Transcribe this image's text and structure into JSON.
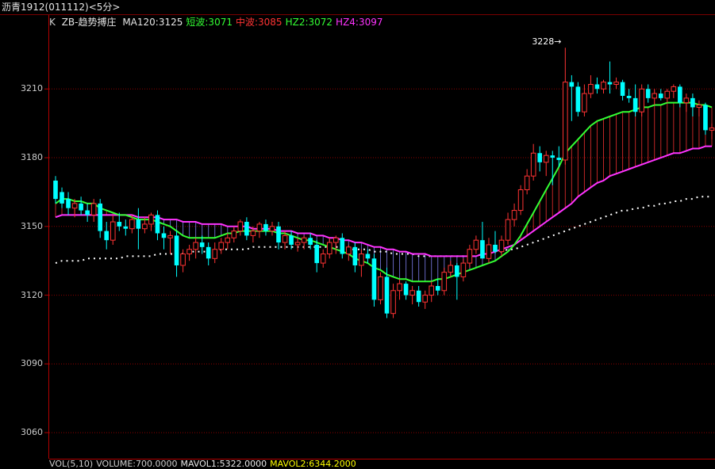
{
  "window": {
    "title": "沥青1912(011112)<5分>"
  },
  "legend": {
    "prefix": "K",
    "indicator": "ZB-趋势搏庄",
    "items": [
      {
        "text": "MA120:3125",
        "color": "#e6e6e6"
      },
      {
        "text": "短波:3071",
        "color": "#33ff33"
      },
      {
        "text": "中波:3085",
        "color": "#ff3333"
      },
      {
        "text": "HZ2:3072",
        "color": "#33ff33"
      },
      {
        "text": "HZ4:3097",
        "color": "#ff33ff"
      }
    ]
  },
  "volume_bar": {
    "items": [
      {
        "text": "VOL(5,10)",
        "color": "#ccc"
      },
      {
        "text": "VOLUME:700.0000",
        "color": "#ccc"
      },
      {
        "text": "MAVOL1:5322.0000",
        "color": "#e6e6e6"
      },
      {
        "text": "MAVOL2:6344.2000",
        "color": "#ffff00"
      }
    ]
  },
  "annotations": {
    "peak": "3228"
  },
  "colors": {
    "up": "#ff3333",
    "down": "#00ffff",
    "hz2": "#33ff33",
    "hz4": "#ff33ff",
    "ma120": "#ffffff",
    "grid": "#8b0000"
  },
  "chart_data": {
    "type": "candlestick",
    "ylim": [
      3050,
      3235
    ],
    "yticks": [
      3060,
      3090,
      3120,
      3150,
      3180,
      3210
    ],
    "grid": true,
    "candles": [
      {
        "o": 3170,
        "h": 3172,
        "l": 3160,
        "c": 3162
      },
      {
        "o": 3165,
        "h": 3167,
        "l": 3158,
        "c": 3160
      },
      {
        "o": 3162,
        "h": 3165,
        "l": 3155,
        "c": 3158
      },
      {
        "o": 3158,
        "h": 3162,
        "l": 3154,
        "c": 3160
      },
      {
        "o": 3160,
        "h": 3163,
        "l": 3155,
        "c": 3157
      },
      {
        "o": 3157,
        "h": 3160,
        "l": 3152,
        "c": 3155
      },
      {
        "o": 3155,
        "h": 3162,
        "l": 3152,
        "c": 3160
      },
      {
        "o": 3160,
        "h": 3162,
        "l": 3145,
        "c": 3148
      },
      {
        "o": 3148,
        "h": 3152,
        "l": 3140,
        "c": 3144
      },
      {
        "o": 3144,
        "h": 3155,
        "l": 3142,
        "c": 3152
      },
      {
        "o": 3152,
        "h": 3156,
        "l": 3148,
        "c": 3150
      },
      {
        "o": 3150,
        "h": 3153,
        "l": 3146,
        "c": 3149
      },
      {
        "o": 3149,
        "h": 3155,
        "l": 3147,
        "c": 3153
      },
      {
        "o": 3153,
        "h": 3158,
        "l": 3140,
        "c": 3149
      },
      {
        "o": 3149,
        "h": 3154,
        "l": 3147,
        "c": 3151
      },
      {
        "o": 3151,
        "h": 3156,
        "l": 3148,
        "c": 3155
      },
      {
        "o": 3155,
        "h": 3157,
        "l": 3144,
        "c": 3147
      },
      {
        "o": 3147,
        "h": 3150,
        "l": 3140,
        "c": 3145
      },
      {
        "o": 3145,
        "h": 3148,
        "l": 3138,
        "c": 3146
      },
      {
        "o": 3146,
        "h": 3148,
        "l": 3128,
        "c": 3133
      },
      {
        "o": 3133,
        "h": 3140,
        "l": 3130,
        "c": 3138
      },
      {
        "o": 3138,
        "h": 3142,
        "l": 3135,
        "c": 3140
      },
      {
        "o": 3140,
        "h": 3145,
        "l": 3136,
        "c": 3143
      },
      {
        "o": 3143,
        "h": 3146,
        "l": 3138,
        "c": 3141
      },
      {
        "o": 3141,
        "h": 3143,
        "l": 3133,
        "c": 3136
      },
      {
        "o": 3136,
        "h": 3143,
        "l": 3134,
        "c": 3140
      },
      {
        "o": 3140,
        "h": 3145,
        "l": 3138,
        "c": 3143
      },
      {
        "o": 3143,
        "h": 3147,
        "l": 3140,
        "c": 3145
      },
      {
        "o": 3145,
        "h": 3150,
        "l": 3143,
        "c": 3148
      },
      {
        "o": 3148,
        "h": 3153,
        "l": 3146,
        "c": 3152
      },
      {
        "o": 3152,
        "h": 3154,
        "l": 3144,
        "c": 3146
      },
      {
        "o": 3146,
        "h": 3150,
        "l": 3143,
        "c": 3148
      },
      {
        "o": 3148,
        "h": 3152,
        "l": 3145,
        "c": 3151
      },
      {
        "o": 3151,
        "h": 3153,
        "l": 3146,
        "c": 3148
      },
      {
        "o": 3148,
        "h": 3152,
        "l": 3146,
        "c": 3150
      },
      {
        "o": 3150,
        "h": 3152,
        "l": 3140,
        "c": 3143
      },
      {
        "o": 3143,
        "h": 3148,
        "l": 3140,
        "c": 3146
      },
      {
        "o": 3146,
        "h": 3148,
        "l": 3140,
        "c": 3142
      },
      {
        "o": 3142,
        "h": 3145,
        "l": 3139,
        "c": 3143
      },
      {
        "o": 3143,
        "h": 3146,
        "l": 3140,
        "c": 3145
      },
      {
        "o": 3145,
        "h": 3147,
        "l": 3140,
        "c": 3142
      },
      {
        "o": 3142,
        "h": 3144,
        "l": 3130,
        "c": 3134
      },
      {
        "o": 3134,
        "h": 3140,
        "l": 3132,
        "c": 3138
      },
      {
        "o": 3138,
        "h": 3145,
        "l": 3136,
        "c": 3143
      },
      {
        "o": 3143,
        "h": 3146,
        "l": 3138,
        "c": 3145
      },
      {
        "o": 3145,
        "h": 3147,
        "l": 3136,
        "c": 3138
      },
      {
        "o": 3138,
        "h": 3142,
        "l": 3135,
        "c": 3141
      },
      {
        "o": 3141,
        "h": 3143,
        "l": 3130,
        "c": 3133
      },
      {
        "o": 3133,
        "h": 3140,
        "l": 3128,
        "c": 3138
      },
      {
        "o": 3138,
        "h": 3140,
        "l": 3134,
        "c": 3136
      },
      {
        "o": 3136,
        "h": 3138,
        "l": 3115,
        "c": 3118
      },
      {
        "o": 3118,
        "h": 3130,
        "l": 3116,
        "c": 3128
      },
      {
        "o": 3128,
        "h": 3132,
        "l": 3110,
        "c": 3112
      },
      {
        "o": 3112,
        "h": 3125,
        "l": 3110,
        "c": 3122
      },
      {
        "o": 3122,
        "h": 3127,
        "l": 3118,
        "c": 3125
      },
      {
        "o": 3125,
        "h": 3126,
        "l": 3118,
        "c": 3120
      },
      {
        "o": 3120,
        "h": 3124,
        "l": 3116,
        "c": 3122
      },
      {
        "o": 3122,
        "h": 3124,
        "l": 3115,
        "c": 3117
      },
      {
        "o": 3117,
        "h": 3122,
        "l": 3114,
        "c": 3120
      },
      {
        "o": 3120,
        "h": 3126,
        "l": 3117,
        "c": 3124
      },
      {
        "o": 3124,
        "h": 3127,
        "l": 3120,
        "c": 3122
      },
      {
        "o": 3122,
        "h": 3132,
        "l": 3120,
        "c": 3130
      },
      {
        "o": 3130,
        "h": 3135,
        "l": 3128,
        "c": 3133
      },
      {
        "o": 3133,
        "h": 3134,
        "l": 3118,
        "c": 3128
      },
      {
        "o": 3128,
        "h": 3136,
        "l": 3126,
        "c": 3134
      },
      {
        "o": 3134,
        "h": 3142,
        "l": 3132,
        "c": 3140
      },
      {
        "o": 3140,
        "h": 3146,
        "l": 3138,
        "c": 3144
      },
      {
        "o": 3144,
        "h": 3152,
        "l": 3140,
        "c": 3136
      },
      {
        "o": 3136,
        "h": 3145,
        "l": 3134,
        "c": 3142
      },
      {
        "o": 3142,
        "h": 3148,
        "l": 3138,
        "c": 3139
      },
      {
        "o": 3139,
        "h": 3146,
        "l": 3137,
        "c": 3144
      },
      {
        "o": 3144,
        "h": 3156,
        "l": 3142,
        "c": 3153
      },
      {
        "o": 3153,
        "h": 3160,
        "l": 3150,
        "c": 3157
      },
      {
        "o": 3157,
        "h": 3168,
        "l": 3155,
        "c": 3166
      },
      {
        "o": 3166,
        "h": 3175,
        "l": 3164,
        "c": 3172
      },
      {
        "o": 3172,
        "h": 3186,
        "l": 3170,
        "c": 3182
      },
      {
        "o": 3182,
        "h": 3185,
        "l": 3174,
        "c": 3178
      },
      {
        "o": 3178,
        "h": 3183,
        "l": 3172,
        "c": 3181
      },
      {
        "o": 3181,
        "h": 3183,
        "l": 3168,
        "c": 3180
      },
      {
        "o": 3180,
        "h": 3185,
        "l": 3176,
        "c": 3179
      },
      {
        "o": 3179,
        "h": 3228,
        "l": 3177,
        "c": 3213
      },
      {
        "o": 3213,
        "h": 3216,
        "l": 3196,
        "c": 3211
      },
      {
        "o": 3211,
        "h": 3213,
        "l": 3198,
        "c": 3200
      },
      {
        "o": 3200,
        "h": 3212,
        "l": 3198,
        "c": 3208
      },
      {
        "o": 3208,
        "h": 3216,
        "l": 3206,
        "c": 3212
      },
      {
        "o": 3212,
        "h": 3215,
        "l": 3208,
        "c": 3210
      },
      {
        "o": 3210,
        "h": 3214,
        "l": 3208,
        "c": 3213
      },
      {
        "o": 3213,
        "h": 3222,
        "l": 3208,
        "c": 3212
      },
      {
        "o": 3212,
        "h": 3215,
        "l": 3210,
        "c": 3213
      },
      {
        "o": 3213,
        "h": 3214,
        "l": 3205,
        "c": 3207
      },
      {
        "o": 3207,
        "h": 3210,
        "l": 3204,
        "c": 3206
      },
      {
        "o": 3206,
        "h": 3212,
        "l": 3198,
        "c": 3200
      },
      {
        "o": 3200,
        "h": 3212,
        "l": 3198,
        "c": 3210
      },
      {
        "o": 3210,
        "h": 3212,
        "l": 3204,
        "c": 3206
      },
      {
        "o": 3206,
        "h": 3210,
        "l": 3203,
        "c": 3208
      },
      {
        "o": 3208,
        "h": 3210,
        "l": 3205,
        "c": 3206
      },
      {
        "o": 3206,
        "h": 3210,
        "l": 3204,
        "c": 3209
      },
      {
        "o": 3209,
        "h": 3212,
        "l": 3206,
        "c": 3211
      },
      {
        "o": 3211,
        "h": 3212,
        "l": 3202,
        "c": 3204
      },
      {
        "o": 3204,
        "h": 3208,
        "l": 3200,
        "c": 3206
      },
      {
        "o": 3206,
        "h": 3208,
        "l": 3198,
        "c": 3202
      },
      {
        "o": 3202,
        "h": 3205,
        "l": 3198,
        "c": 3203
      },
      {
        "o": 3203,
        "h": 3204,
        "l": 3190,
        "c": 3192
      },
      {
        "o": 3192,
        "h": 3195,
        "l": 3188,
        "c": 3193
      }
    ],
    "hz2": [
      3160,
      3162,
      3162,
      3161,
      3161,
      3160,
      3160,
      3158,
      3157,
      3156,
      3155,
      3155,
      3154,
      3153,
      3153,
      3153,
      3152,
      3151,
      3150,
      3148,
      3146,
      3145,
      3145,
      3145,
      3145,
      3145,
      3146,
      3147,
      3147,
      3148,
      3148,
      3148,
      3148,
      3148,
      3148,
      3147,
      3147,
      3146,
      3145,
      3144,
      3144,
      3143,
      3142,
      3141,
      3140,
      3139,
      3138,
      3136,
      3135,
      3134,
      3132,
      3131,
      3129,
      3128,
      3127,
      3127,
      3126,
      3126,
      3126,
      3126,
      3127,
      3127,
      3128,
      3129,
      3130,
      3131,
      3132,
      3133,
      3134,
      3135,
      3137,
      3139,
      3142,
      3146,
      3151,
      3156,
      3161,
      3166,
      3171,
      3176,
      3182,
      3185,
      3188,
      3191,
      3194,
      3196,
      3197,
      3198,
      3199,
      3200,
      3200,
      3201,
      3202,
      3202,
      3203,
      3203,
      3204,
      3204,
      3204,
      3204,
      3204,
      3203,
      3203,
      3202
    ],
    "hz4": [
      3154,
      3155,
      3155,
      3155,
      3155,
      3155,
      3155,
      3155,
      3155,
      3155,
      3155,
      3155,
      3155,
      3154,
      3154,
      3154,
      3154,
      3153,
      3153,
      3153,
      3152,
      3152,
      3152,
      3151,
      3151,
      3151,
      3151,
      3150,
      3150,
      3150,
      3150,
      3149,
      3149,
      3149,
      3149,
      3148,
      3148,
      3148,
      3147,
      3147,
      3147,
      3146,
      3146,
      3145,
      3145,
      3144,
      3144,
      3143,
      3143,
      3142,
      3141,
      3141,
      3140,
      3140,
      3139,
      3139,
      3138,
      3138,
      3138,
      3137,
      3137,
      3137,
      3137,
      3137,
      3137,
      3137,
      3137,
      3138,
      3138,
      3139,
      3140,
      3141,
      3142,
      3144,
      3146,
      3148,
      3150,
      3152,
      3154,
      3156,
      3158,
      3160,
      3163,
      3165,
      3167,
      3169,
      3170,
      3172,
      3173,
      3174,
      3175,
      3176,
      3177,
      3178,
      3179,
      3180,
      3181,
      3182,
      3182,
      3183,
      3184,
      3184,
      3185,
      3185
    ],
    "ma120": [
      3134,
      3135,
      3135,
      3135,
      3135,
      3136,
      3136,
      3136,
      3136,
      3136,
      3136,
      3137,
      3137,
      3137,
      3137,
      3137,
      3138,
      3138,
      3138,
      3138,
      3138,
      3139,
      3139,
      3139,
      3139,
      3139,
      3140,
      3140,
      3140,
      3140,
      3140,
      3141,
      3141,
      3141,
      3141,
      3141,
      3141,
      3141,
      3141,
      3141,
      3141,
      3141,
      3141,
      3141,
      3141,
      3141,
      3140,
      3140,
      3140,
      3140,
      3139,
      3139,
      3139,
      3138,
      3138,
      3138,
      3138,
      3137,
      3137,
      3137,
      3137,
      3137,
      3137,
      3137,
      3137,
      3137,
      3137,
      3138,
      3138,
      3139,
      3139,
      3140,
      3140,
      3141,
      3142,
      3143,
      3144,
      3145,
      3146,
      3147,
      3148,
      3149,
      3150,
      3151,
      3152,
      3153,
      3154,
      3155,
      3156,
      3157,
      3157,
      3158,
      3158,
      3159,
      3159,
      3160,
      3160,
      3161,
      3161,
      3162,
      3162,
      3163,
      3163,
      3163
    ]
  }
}
